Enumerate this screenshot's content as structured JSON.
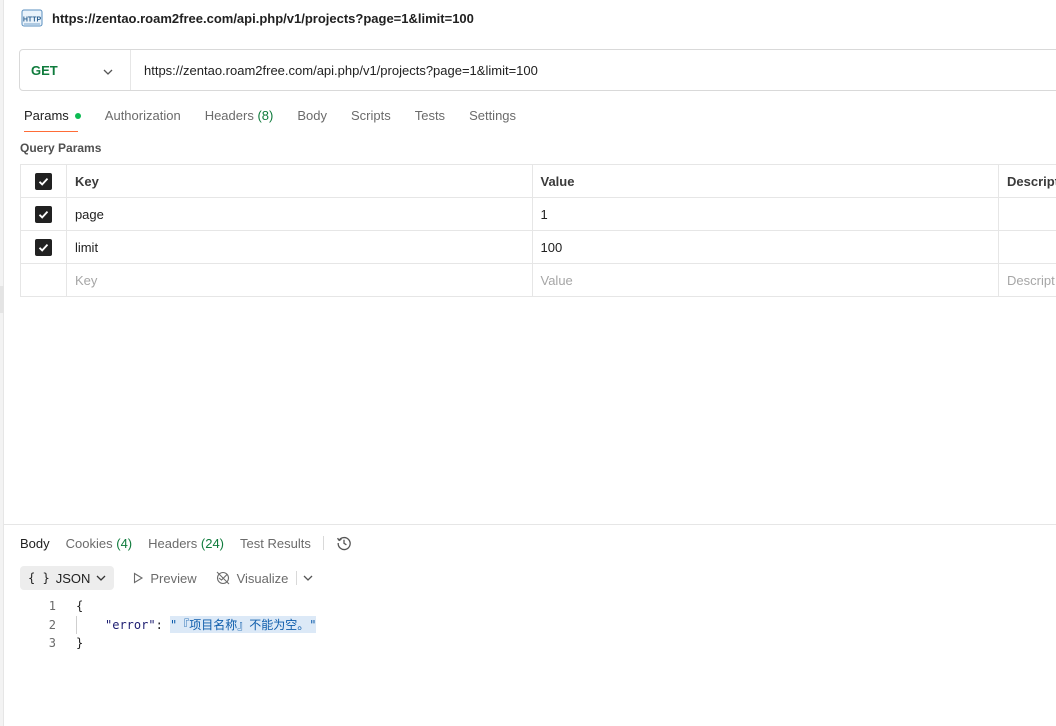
{
  "request": {
    "title": "https://zentao.roam2free.com/api.php/v1/projects?page=1&limit=100",
    "icon": "http-icon",
    "method": "GET",
    "url": "https://zentao.roam2free.com/api.php/v1/projects?page=1&limit=100"
  },
  "request_tabs": {
    "params": "Params",
    "authorization": "Authorization",
    "headers": "Headers",
    "headers_count": "(8)",
    "body": "Body",
    "scripts": "Scripts",
    "tests": "Tests",
    "settings": "Settings"
  },
  "query_params": {
    "section_label": "Query Params",
    "columns": {
      "key": "Key",
      "value": "Value",
      "description": "Descript"
    },
    "rows": [
      {
        "key": "page",
        "value": "1",
        "checked": true
      },
      {
        "key": "limit",
        "value": "100",
        "checked": true
      }
    ],
    "empty_row": {
      "key": "Key",
      "value": "Value",
      "description": "Descript"
    }
  },
  "response_tabs": {
    "body": "Body",
    "cookies": "Cookies",
    "cookies_count": "(4)",
    "headers": "Headers",
    "headers_count": "(24)",
    "test_results": "Test Results"
  },
  "response_toolbar": {
    "format_braces": "{ }",
    "format": "JSON",
    "preview": "Preview",
    "visualize": "Visualize"
  },
  "response_body": {
    "lines": [
      "1",
      "2",
      "3"
    ],
    "open_brace": "{",
    "key": "\"error\"",
    "colon": ": ",
    "value": "\"『项目名称』不能为空。\"",
    "close_brace": "}"
  },
  "colors": {
    "method_get": "#0f7b3c",
    "active_tab_underline": "#ff6c37",
    "params_dot": "#0cbb52",
    "count": "#0f7b3c"
  }
}
